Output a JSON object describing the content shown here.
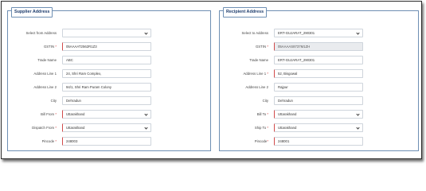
{
  "supplier": {
    "title": "Supplier Address",
    "fields": {
      "select_from_address": {
        "label": "Select from Address",
        "value": ""
      },
      "gstin": {
        "label": "GSTIN",
        "required": "*",
        "value": "05AAAAT2562R1Z3"
      },
      "trade_name": {
        "label": "Trade Name",
        "value": "ABC"
      },
      "address_line_1": {
        "label": "Address Line 1",
        "value": "24, Shri Ram Complex,"
      },
      "address_line_2": {
        "label": "Address Line 2",
        "value": "94/1, Shri Ram Puram Colony"
      },
      "city": {
        "label": "City",
        "value": "Dehradun"
      },
      "bill_from": {
        "label": "Bill From",
        "required": "*",
        "value": "Uttarakhand"
      },
      "dispatch_from": {
        "label": "Dispatch From",
        "required": "*",
        "value": "Uttarakhand"
      },
      "pincode": {
        "label": "Pincode",
        "required": "*",
        "value": "248003"
      }
    }
  },
  "recipient": {
    "title": "Recipient Address",
    "fields": {
      "select_to_address": {
        "label": "Select to Address",
        "value": "ERT-GUJARAT_290301"
      },
      "gstin": {
        "label": "GSTIN",
        "required": "*",
        "value": "05AAAAS8737M1ZH"
      },
      "trade_name": {
        "label": "Trade Name",
        "value": "ERT-GUJARAT_290301"
      },
      "address_line_1": {
        "label": "Address Line 1",
        "required": "*",
        "value": "52, Bisgowal"
      },
      "address_line_2": {
        "label": "Address Line 2",
        "value": "Rajpur"
      },
      "city": {
        "label": "City",
        "value": "Dehradun"
      },
      "bill_to": {
        "label": "Bill To",
        "required": "*",
        "value": "Uttarakhand"
      },
      "ship_to": {
        "label": "Ship To",
        "required": "*",
        "value": "Uttarakhand"
      },
      "pincode": {
        "label": "Pincode",
        "required": "*",
        "value": "248001"
      }
    }
  }
}
